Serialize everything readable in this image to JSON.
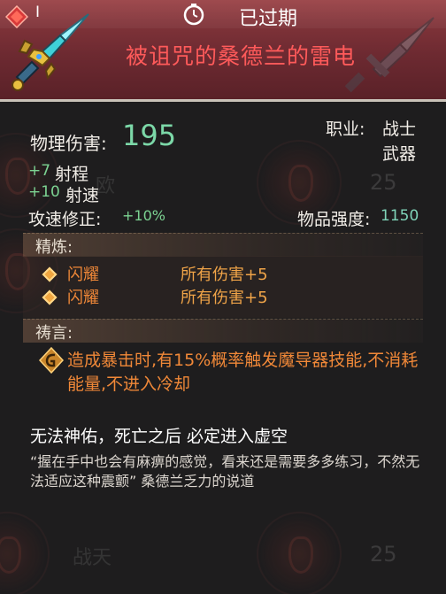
{
  "header": {
    "rarity_label": "I",
    "status_label": "已过期",
    "item_name": "被诅咒的桑德兰的雷电"
  },
  "stats": {
    "damage_label": "物理伤害:",
    "damage_value": "195",
    "range_bonus": "+7",
    "range_label": "射程",
    "speed_bonus": "+10",
    "speed_label": "射速",
    "attack_speed_label": "攻速修正:",
    "attack_speed_value": "+10%",
    "class_label": "职业:",
    "class_value": "战士",
    "type_value": "武器",
    "quality_label": "物品强度:",
    "quality_value": "1150"
  },
  "refine": {
    "title": "精炼:",
    "affixes": [
      {
        "name": "闪耀",
        "effect": "所有伤害+5"
      },
      {
        "name": "闪耀",
        "effect": "所有伤害+5"
      }
    ]
  },
  "prayer": {
    "title": "祷言:",
    "text": "造成暴击时,有15%概率触发魔导器技能,不消耗能量,不进入冷却"
  },
  "curse_text": "无法神佑，死亡之后 必定进入虚空",
  "quote_text": "“握在手中也会有麻痹的感觉，看来还是需要多多练习，不然无法适应这种震颤”  桑德兰乏力的说道",
  "background": {
    "watermark_text_1": "欧",
    "watermark_num_1": "25",
    "watermark_text_2": "战天",
    "watermark_num_2": "25"
  },
  "colors": {
    "header": "#6d2a31",
    "item_name": "#ff5a5a",
    "damage_value": "#7cd8a8",
    "bonus_green": "#7cd392",
    "affix_orange": "#f08838"
  },
  "icons": [
    "rarity-gem-icon",
    "clock-icon",
    "weapon-sword-icon",
    "sword-watermark-icon",
    "prayer-rune-icon",
    "diamond-bullet-icon"
  ]
}
